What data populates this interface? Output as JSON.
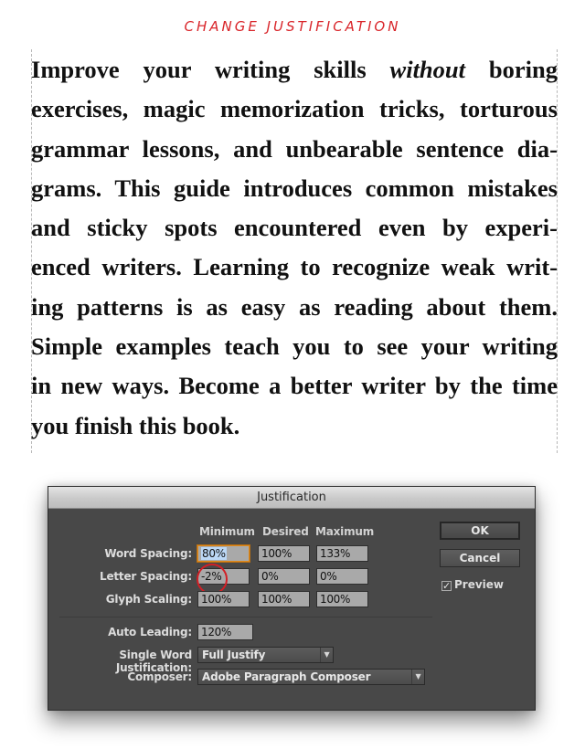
{
  "annotation": {
    "text": "CHANGE JUSTIFICATION",
    "color": "#d9262b"
  },
  "paragraph": {
    "lines": [
      {
        "before": "Improve your writing skills ",
        "italic": "without",
        "after": " boring"
      },
      {
        "text": "exercises, magic memorization tricks, torturous"
      },
      {
        "text": "grammar lessons, and unbearable sentence dia-"
      },
      {
        "text": "grams. This guide introduces common mistakes"
      },
      {
        "text": "and sticky spots encountered even by experi-"
      },
      {
        "text": "enced writers. Learning to recognize weak writ-"
      },
      {
        "text": "ing patterns is as easy as reading about them."
      },
      {
        "text": "Simple examples teach you to see your writing"
      },
      {
        "text": "in new ways. Become a better writer by the time"
      },
      {
        "text": "you finish this book."
      }
    ]
  },
  "dialog": {
    "title": "Justification",
    "columns": [
      "Minimum",
      "Desired",
      "Maximum"
    ],
    "rows": [
      {
        "label": "Word Spacing:",
        "values": [
          "80%",
          "100%",
          "133%"
        ]
      },
      {
        "label": "Letter Spacing:",
        "values": [
          "-2%",
          "0%",
          "0%"
        ]
      },
      {
        "label": "Glyph Scaling:",
        "values": [
          "100%",
          "100%",
          "100%"
        ]
      }
    ],
    "auto_leading": {
      "label": "Auto Leading:",
      "value": "120%"
    },
    "single_word_justification": {
      "label": "Single Word Justification:",
      "value": "Full Justify"
    },
    "composer": {
      "label": "Composer:",
      "value": "Adobe Paragraph Composer"
    },
    "buttons": {
      "ok": "OK",
      "cancel": "Cancel"
    },
    "preview": {
      "label": "Preview",
      "checked": true,
      "check_glyph": "✓"
    },
    "dropdown_arrow": "▼",
    "highlight_circle_color": "#d21f25",
    "focus_color": "#e08a1c"
  }
}
